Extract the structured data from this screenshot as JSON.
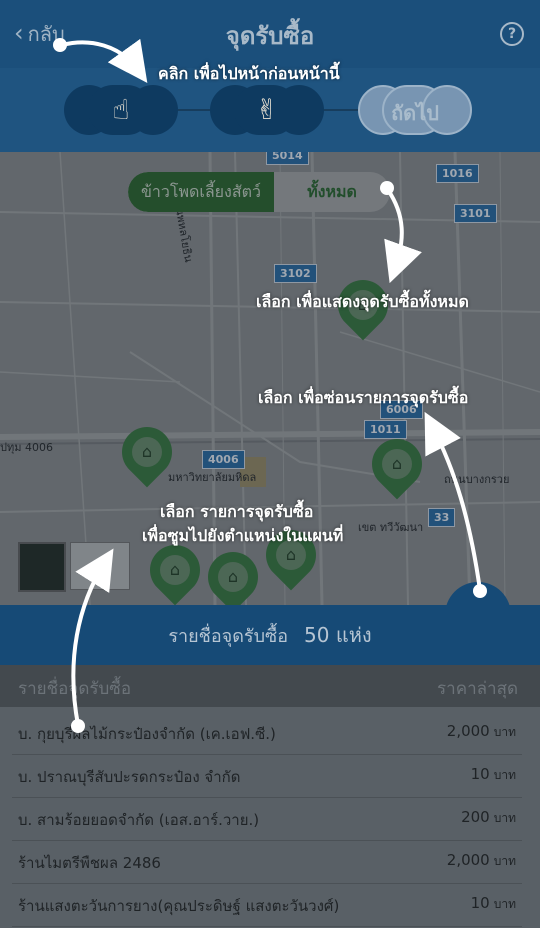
{
  "header": {
    "back_label": "กลับ",
    "title": "จุดรับซื้อ",
    "help_icon": "?"
  },
  "stepper": {
    "step1_icon": "☝",
    "step2_icon": "✌",
    "next_label": "ถัดไป"
  },
  "map": {
    "toggle": {
      "left_label": "ข้าวโพดเลี้ยงสัตว์",
      "right_label": "ทั้งหมด"
    },
    "shields": [
      "5014",
      "1016",
      "3101",
      "3102",
      "6006",
      "1011",
      "4006",
      "33"
    ],
    "road_labels": [
      "ถนนพหลโยธิน",
      "มหาวิทยาลัยมหิดล",
      "ปทุม 4006",
      "เขต ทวีวัฒนา",
      "ถนนบางกรวย"
    ]
  },
  "hints": {
    "back_hint": "คลิก  เพื่อไปหน้าก่อนหน้านี้",
    "all_hint": "เลือก  เพื่อแสดงจุดรับซื้อทั้งหมด",
    "hide_hint": "เลือก  เพื่อซ่อนรายการจุดรับซื้อ",
    "zoom_hint_1": "เลือก  รายการจุดรับซื้อ",
    "zoom_hint_2": "เพื่อซูมไปยังตำแหน่งในแผนที่"
  },
  "summary": {
    "label": "รายชื่อจุดรับซื้อ",
    "count": "50 แห่ง"
  },
  "list": {
    "col_name": "รายชื่อจุดรับซื้อ",
    "col_price": "ราคาล่าสุด",
    "unit": "บาท",
    "rows": [
      {
        "name": "บ. กุยบุรีผลไม้กระป๋องจำกัด (เค.เอฟ.ซี.)",
        "price": "2,000"
      },
      {
        "name": "บ. ปราณบุรีสับปะรดกระป๋อง จำกัด",
        "price": "10"
      },
      {
        "name": "บ. สามร้อยยอดจำกัด (เอส.อาร์.วาย.)",
        "price": "200"
      },
      {
        "name": "ร้านไมตรีพืชผล 2486",
        "price": "2,000"
      },
      {
        "name": "ร้านแสงตะวันการยาง(คุณประดิษฐ์ แสงตะวันวงศ์)",
        "price": "10"
      }
    ]
  },
  "colors": {
    "header": "#1b4f7b",
    "marker": "#3d7d44",
    "summary": "#164a76"
  }
}
